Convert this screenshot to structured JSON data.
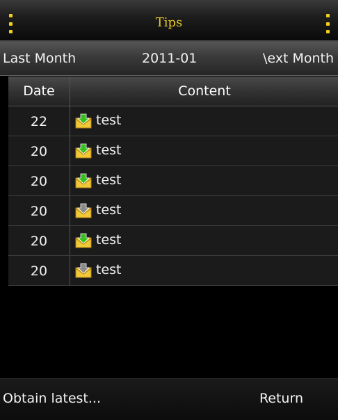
{
  "header": {
    "title": "Tips",
    "menu_icon": "vertical-dots-icon"
  },
  "month_nav": {
    "prev_label": "Last Month",
    "current": "2011-01",
    "next_label": "\\ext Month"
  },
  "table": {
    "columns": [
      "Date",
      "Content"
    ],
    "rows": [
      {
        "date": "22",
        "status": "unread",
        "icon": "envelope-green-arrow-icon",
        "content": "test"
      },
      {
        "date": "20",
        "status": "unread",
        "icon": "envelope-green-arrow-icon",
        "content": "test"
      },
      {
        "date": "20",
        "status": "unread",
        "icon": "envelope-green-arrow-icon",
        "content": "test"
      },
      {
        "date": "20",
        "status": "read",
        "icon": "envelope-grey-arrow-icon",
        "content": "test"
      },
      {
        "date": "20",
        "status": "unread",
        "icon": "envelope-green-arrow-icon",
        "content": "test"
      },
      {
        "date": "20",
        "status": "read",
        "icon": "envelope-grey-arrow-icon",
        "content": "test"
      }
    ]
  },
  "softkeys": {
    "left": "Obtain latest...",
    "right": "Return"
  },
  "colors": {
    "title": "#e8c826",
    "menu_dots": "#f0d020",
    "unread_arrow": "#38c020",
    "read_arrow": "#8a8a8a",
    "envelope": "#f0c838"
  }
}
